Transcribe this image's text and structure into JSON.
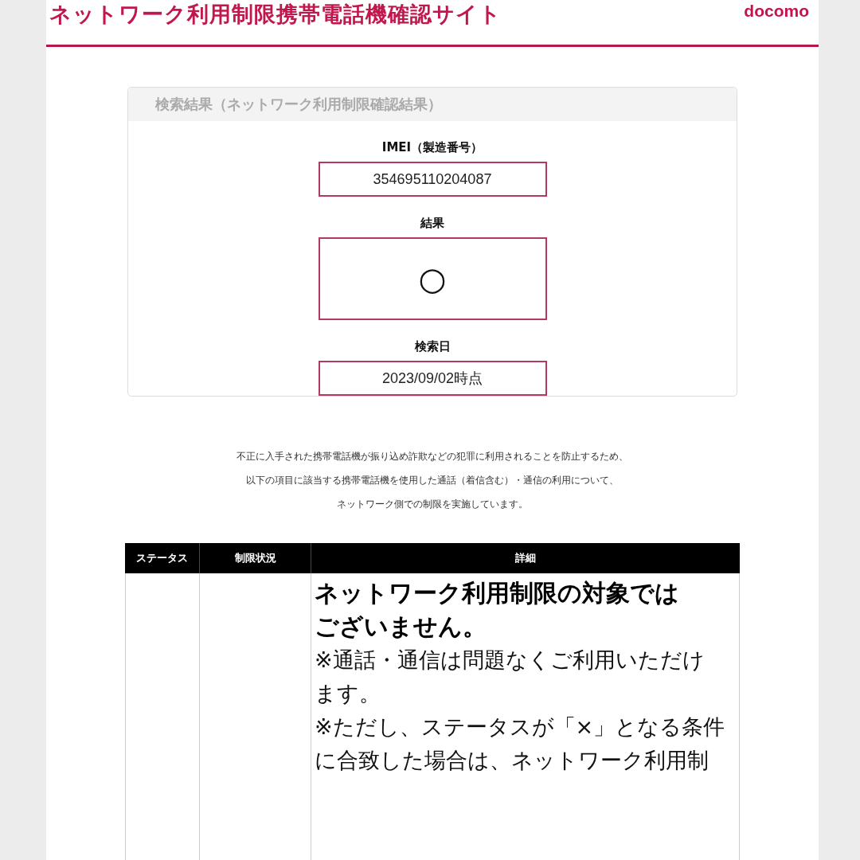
{
  "header": {
    "title": "ネットワーク利用制限携帯電話機確認サイト",
    "logo": "docomo"
  },
  "result_card": {
    "title": "検索結果（ネットワーク利用制限確認結果）",
    "fields": [
      {
        "label": "IMEI（製造番号）",
        "value": "354695110204087",
        "kind": "text"
      },
      {
        "label": "結果",
        "value": "○",
        "kind": "mark"
      },
      {
        "label": "検索日",
        "value": "2023/09/02時点",
        "kind": "text"
      }
    ]
  },
  "notice": [
    "不正に入手された携帯電話機が振り込め詐欺などの犯罪に利用されることを防止するため、",
    "以下の項目に該当する携帯電話機を使用した通話（着信含む）・通信の利用について、",
    "ネットワーク側での制限を実施しています。"
  ],
  "table": {
    "columns": [
      "ステータス",
      "制限状況",
      "詳細"
    ],
    "detail_heading": [
      "ネットワーク利用制限の対象では",
      "ございません。"
    ],
    "detail_lines": [
      "※通話・通信は問題なくご利用いただけ",
      "ます。",
      "※ただし、ステータスが「×」となる条件",
      "に合致した場合は、ネットワーク利用制"
    ]
  }
}
